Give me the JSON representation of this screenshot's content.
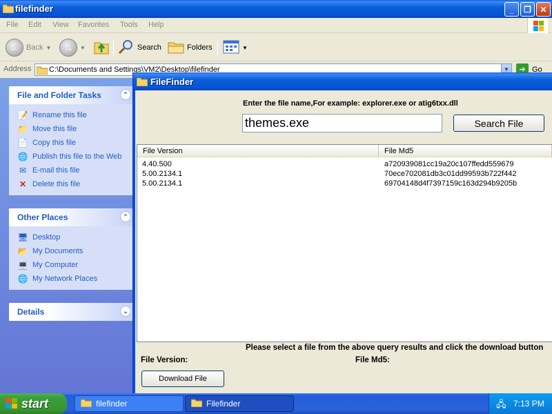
{
  "explorer": {
    "title": "filefinder",
    "menu": [
      "File",
      "Edit",
      "View",
      "Favorites",
      "Tools",
      "Help"
    ],
    "toolbar": {
      "back_label": "Back",
      "search_label": "Search",
      "folders_label": "Folders"
    },
    "address": {
      "label": "Address",
      "path": "C:\\Documents and Settings\\VM2\\Desktop\\filefinder",
      "go_label": "Go"
    },
    "task_panes": {
      "file_tasks": {
        "title": "File and Folder Tasks",
        "items": [
          "Rename this file",
          "Move this file",
          "Copy this file",
          "Publish this file to the Web",
          "E-mail this file",
          "Delete this file"
        ]
      },
      "other_places": {
        "title": "Other Places",
        "items": [
          "Desktop",
          "My Documents",
          "My Computer",
          "My Network Places"
        ]
      },
      "details": {
        "title": "Details"
      }
    }
  },
  "filefinder": {
    "title": "FileFinder",
    "prompt": "Enter the file name,For example: explorer.exe or atig6txx.dll",
    "search_value": "themes.exe",
    "search_button": "Search File",
    "columns": [
      "File Version",
      "File Md5"
    ],
    "rows": [
      [
        "4.40.500",
        "a720939081cc19a20c107ffedd559679"
      ],
      [
        "5.00.2134.1",
        "70ece702081db3c01dd99593b722f442"
      ],
      [
        "5.00.2134.1",
        "69704148d4f7397159c163d294b9205b"
      ]
    ],
    "hint": "Please select a file from the above query results and click the download button",
    "file_version_label": "File Version:",
    "file_md5_label": "File Md5:",
    "download_button": "Download File"
  },
  "taskbar": {
    "start_label": "start",
    "tasks": [
      "filefinder",
      "Filefinder"
    ],
    "clock": "7:13 PM"
  },
  "colors": {
    "titlebar_blue": "#0453d4",
    "task_link_blue": "#215dc6",
    "start_green": "#3c9e3c"
  }
}
